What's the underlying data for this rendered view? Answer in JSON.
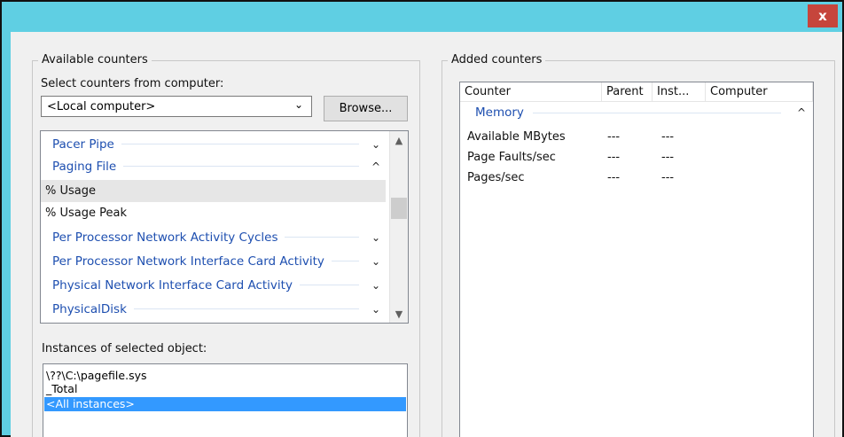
{
  "window": {
    "close_label": "x"
  },
  "available_group": {
    "title": "Available counters",
    "select_label": "Select counters from computer:",
    "computer_value": "<Local computer>",
    "browse_label": "Browse...",
    "counters": [
      {
        "type": "category",
        "label": "Pacer Pipe",
        "chevron": "⌄"
      },
      {
        "type": "category",
        "label": "Paging File",
        "chevron": "^"
      },
      {
        "type": "item",
        "label": "% Usage",
        "selected": true
      },
      {
        "type": "item",
        "label": "% Usage Peak"
      },
      {
        "type": "category",
        "label": "Per Processor Network Activity Cycles",
        "chevron": "⌄"
      },
      {
        "type": "category",
        "label": "Per Processor Network Interface Card Activity",
        "chevron": "⌄"
      },
      {
        "type": "category",
        "label": "Physical Network Interface Card Activity",
        "chevron": "⌄"
      },
      {
        "type": "category",
        "label": "PhysicalDisk",
        "chevron": "⌄"
      }
    ],
    "instances_label": "Instances of selected object:",
    "instances": [
      "\\??\\C:\\pagefile.sys",
      "_Total",
      "<All instances>"
    ],
    "selected_instance": "<All instances>"
  },
  "added_group": {
    "title": "Added counters",
    "columns": [
      "Counter",
      "Parent",
      "Inst...",
      "Computer"
    ],
    "category": "Memory",
    "category_chevron": "^",
    "rows": [
      {
        "counter": "Available MBytes",
        "parent": "---",
        "instance": "---"
      },
      {
        "counter": "Page Faults/sec",
        "parent": "---",
        "instance": "---"
      },
      {
        "counter": "Pages/sec",
        "parent": "---",
        "instance": "---"
      }
    ]
  },
  "colors": {
    "titlebar": "#5fcfe3",
    "close_button": "#c6453c",
    "category_text": "#1e4fb0",
    "selection": "#3399ff"
  }
}
